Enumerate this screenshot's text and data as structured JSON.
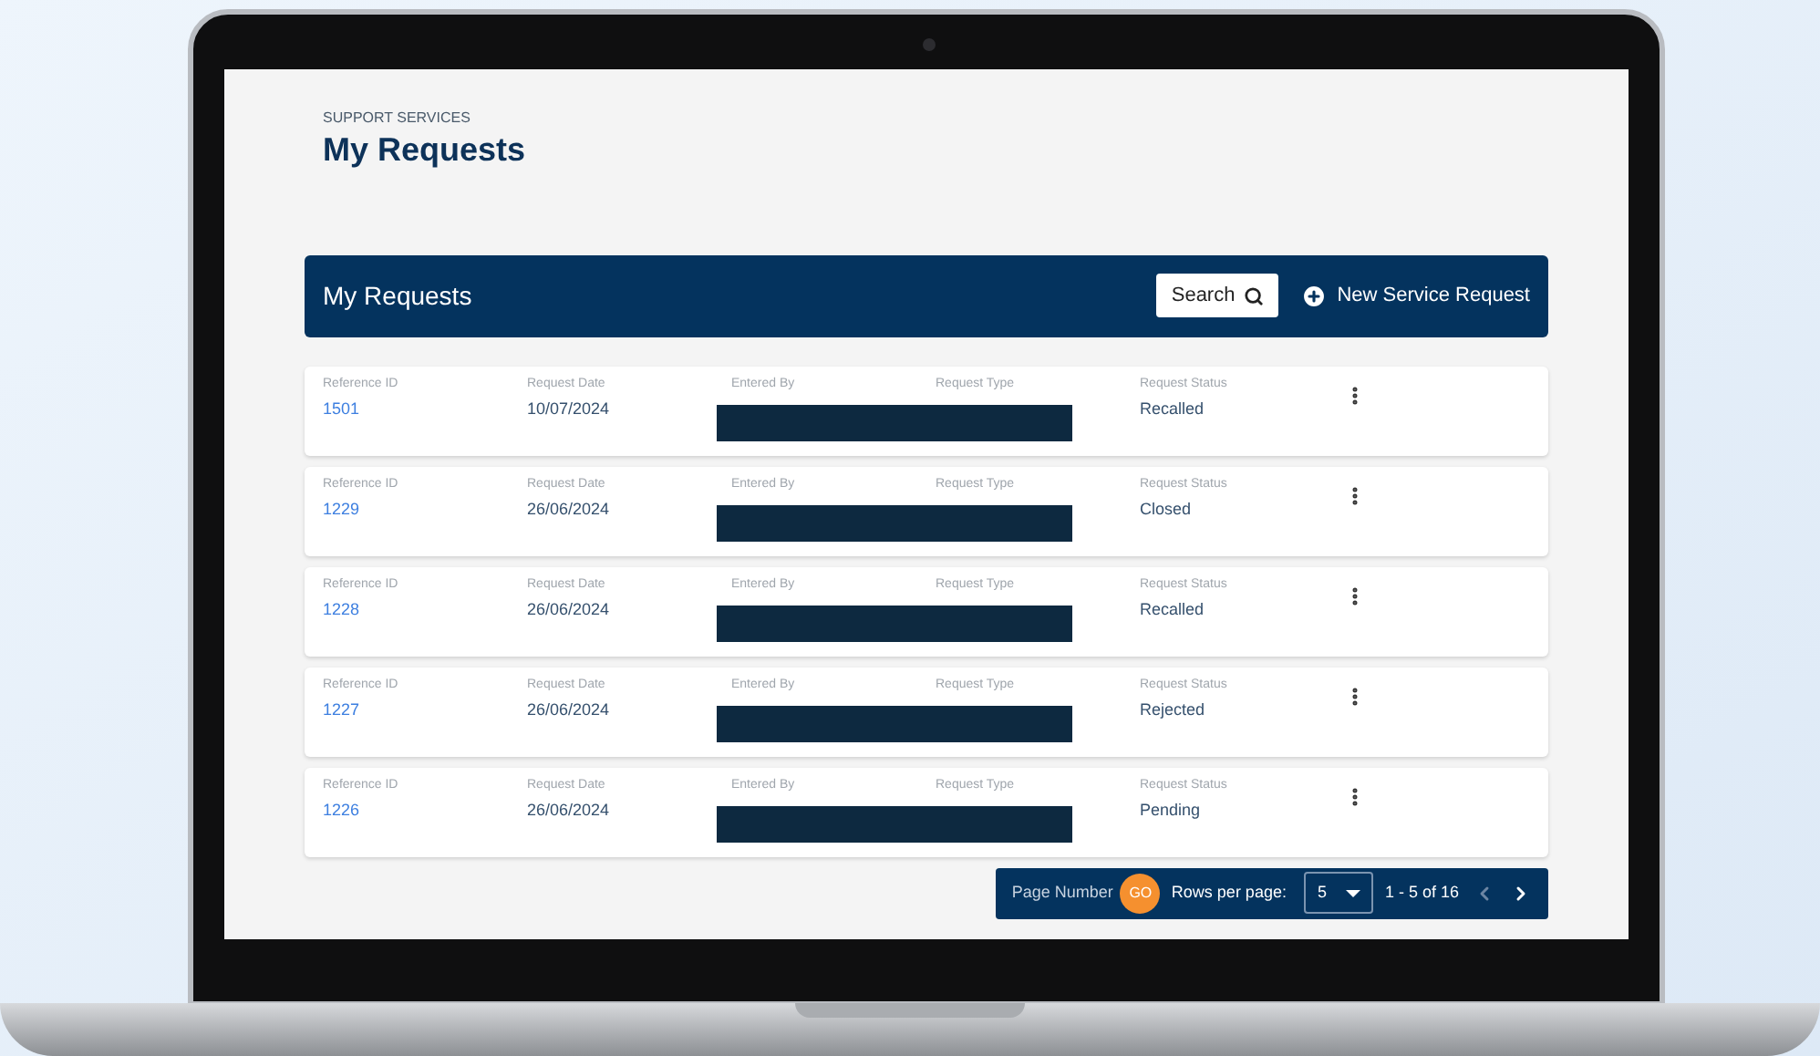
{
  "header": {
    "eyebrow": "SUPPORT SERVICES",
    "title": "My Requests"
  },
  "panel": {
    "title": "My Requests",
    "search_button": "Search",
    "new_button": "New Service Request"
  },
  "rows": [
    {
      "labels": [
        "Reference ID",
        "Request Date",
        "Entered By",
        "Request Type",
        "Request Status"
      ],
      "reference_id": "1501",
      "request_date": "10/07/2024",
      "status": "Recalled",
      "redacted": true
    },
    {
      "labels": [
        "Reference ID",
        "Request Date",
        "Entered By",
        "Request Type",
        "Request Status"
      ],
      "reference_id": "1229",
      "request_date": "26/06/2024",
      "status": "Closed",
      "redacted": true
    },
    {
      "labels": [
        "Reference ID",
        "Request Date",
        "Entered By",
        "Request Type",
        "Request Status"
      ],
      "reference_id": "1228",
      "request_date": "26/06/2024",
      "status": "Recalled",
      "redacted": true
    },
    {
      "labels": [
        "Reference ID",
        "Request Date",
        "Entered By",
        "Request Type",
        "Request Status"
      ],
      "reference_id": "1227",
      "request_date": "26/06/2024",
      "status": "Rejected",
      "redacted": true
    },
    {
      "labels": [
        "Reference ID",
        "Request Date",
        "Entered By",
        "Request Type",
        "Request Status"
      ],
      "reference_id": "1226",
      "request_date": "26/06/2024",
      "status": "Pending",
      "redacted": true
    }
  ],
  "pagination": {
    "page_number_label": "Page Number",
    "go_button": "GO",
    "rows_label": "Rows per page:",
    "rows_value": "5",
    "range": "1 - 5 of 16",
    "prev_disabled": true,
    "next_disabled": false
  }
}
